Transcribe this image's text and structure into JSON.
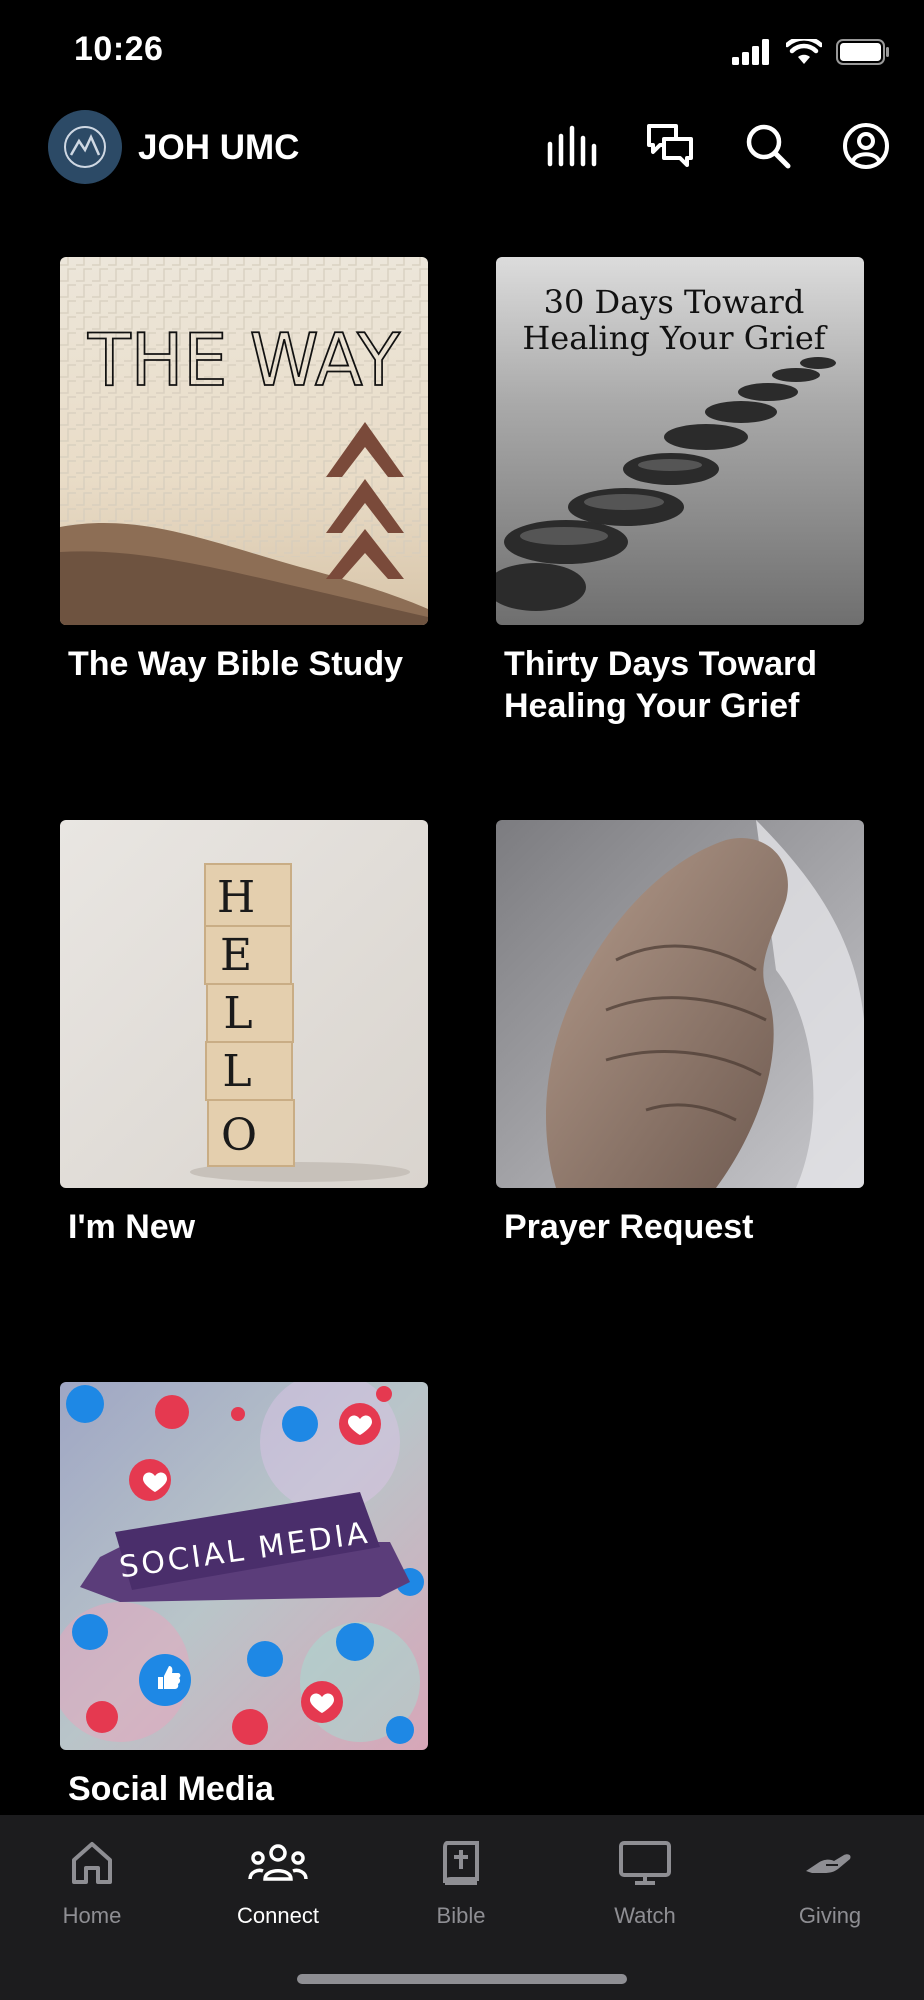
{
  "status": {
    "time": "10:26"
  },
  "header": {
    "title": "JOH UMC"
  },
  "tiles": [
    {
      "label": "The Way Bible Study",
      "art_title": "THE WAY"
    },
    {
      "label": "Thirty Days Toward Healing Your Grief",
      "art_line1": "30 Days Toward",
      "art_line2": "Healing Your Grief"
    },
    {
      "label": "I'm New",
      "art_letters": [
        "H",
        "E",
        "L",
        "L",
        "O"
      ]
    },
    {
      "label": "Prayer Request"
    },
    {
      "label": "Social Media",
      "art_banner": "SOCIAL MEDIA"
    }
  ],
  "tabs": [
    {
      "label": "Home",
      "icon": "home-icon"
    },
    {
      "label": "Connect",
      "icon": "people-icon",
      "active": true
    },
    {
      "label": "Bible",
      "icon": "bible-icon"
    },
    {
      "label": "Watch",
      "icon": "monitor-icon"
    },
    {
      "label": "Giving",
      "icon": "giving-hand-icon"
    }
  ],
  "colors": {
    "background": "#000000",
    "tabbar": "#1c1c1e",
    "logo": "#2c4a66",
    "inactive": "#8e8e93"
  }
}
